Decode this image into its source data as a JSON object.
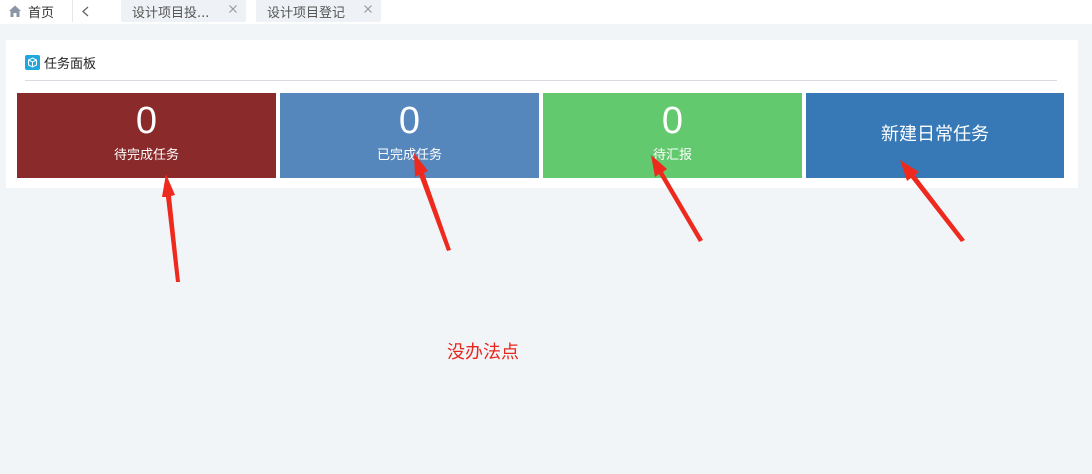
{
  "tabbar": {
    "home_label": "首页",
    "tabs": [
      {
        "label": "设计项目投..."
      },
      {
        "label": "设计项目登记"
      }
    ]
  },
  "panel": {
    "title": "任务面板",
    "cards": [
      {
        "count": "0",
        "label": "待完成任务",
        "color": "#8a2a2b"
      },
      {
        "count": "0",
        "label": "已完成任务",
        "color": "#5587bd"
      },
      {
        "count": "0",
        "label": "待汇报",
        "color": "#63c96e"
      },
      {
        "label": "新建日常任务",
        "color": "#3679b6"
      }
    ]
  },
  "annotation": {
    "note": "没办法点",
    "color": "#e8261e"
  }
}
